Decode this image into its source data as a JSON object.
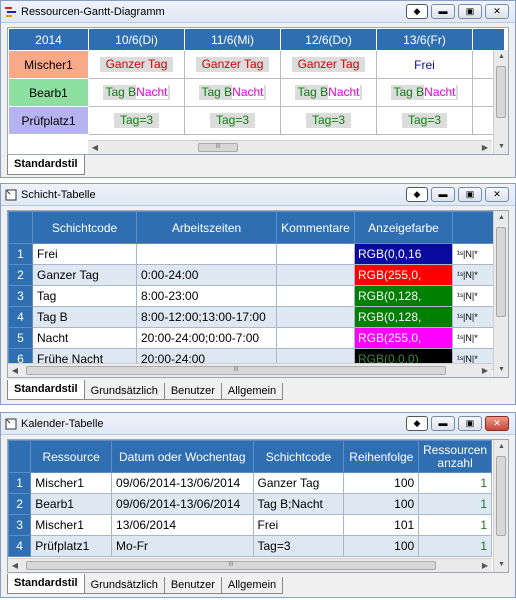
{
  "windows": {
    "gantt": {
      "title": "Ressourcen-Gantt-Diagramm",
      "year": "2014",
      "dates": [
        "10/6(Di)",
        "11/6(Mi)",
        "12/6(Do)",
        "13/6(Fr)"
      ],
      "resources": [
        {
          "name": "Mischer1",
          "color": "#f7a98a",
          "cells": [
            "Ganzer Tag",
            "Ganzer Tag",
            "Ganzer Tag",
            "Frei"
          ]
        },
        {
          "name": "Bearb1",
          "color": "#8ee0a0",
          "cells": [
            "Tag B|Nacht",
            "Tag B|Nacht",
            "Tag B|Nacht",
            "Tag B|Nacht"
          ]
        },
        {
          "name": "Prüfplatz1",
          "color": "#b5b3f0",
          "cells": [
            "Tag=3",
            "Tag=3",
            "Tag=3",
            "Tag=3"
          ]
        }
      ],
      "tabs": [
        "Standardstil"
      ]
    },
    "schicht": {
      "title": "Schicht-Tabelle",
      "columns": [
        "Schichtcode",
        "Arbeitszeiten",
        "Kommentare",
        "Anzeigefarbe"
      ],
      "rows": [
        {
          "n": "1",
          "code": "Frei",
          "zeit": "",
          "komm": "",
          "farbe": "RGB(0,0,16",
          "bg": "#0a0aa0"
        },
        {
          "n": "2",
          "code": "Ganzer Tag",
          "zeit": "0:00-24:00",
          "komm": "",
          "farbe": "RGB(255,0,",
          "bg": "#ff0000"
        },
        {
          "n": "3",
          "code": "Tag",
          "zeit": "8:00-23:00",
          "komm": "",
          "farbe": "RGB(0,128,",
          "bg": "#008000"
        },
        {
          "n": "4",
          "code": "Tag B",
          "zeit": "8:00-12:00;13:00-17:00",
          "komm": "",
          "farbe": "RGB(0,128,",
          "bg": "#008000"
        },
        {
          "n": "5",
          "code": "Nacht",
          "zeit": "20:00-24:00;0:00-7:00",
          "komm": "",
          "farbe": "RGB(255,0,",
          "bg": "#ff00ff"
        },
        {
          "n": "6",
          "code": "Frühe Nacht",
          "zeit": "20:00-24:00",
          "komm": "",
          "farbe": "RGB(0,0,0)",
          "bg": "#000000"
        }
      ],
      "tabs": [
        "Standardstil",
        "Grundsätzlich",
        "Benutzer",
        "Allgemein"
      ]
    },
    "kalender": {
      "title": "Kalender-Tabelle",
      "columns": [
        "Ressource",
        "Datum oder Wochentag",
        "Schichtcode",
        "Reihenfolge",
        "Ressourcen anzahl"
      ],
      "rows": [
        {
          "n": "1",
          "res": "Mischer1",
          "datum": "09/06/2014-13/06/2014",
          "code": "Ganzer Tag",
          "reihe": "100",
          "anz": "1"
        },
        {
          "n": "2",
          "res": "Bearb1",
          "datum": "09/06/2014-13/06/2014",
          "code": "Tag B;Nacht",
          "reihe": "100",
          "anz": "1"
        },
        {
          "n": "3",
          "res": "Mischer1",
          "datum": "13/06/2014",
          "code": "Frei",
          "reihe": "101",
          "anz": "1"
        },
        {
          "n": "4",
          "res": "Prüfplatz1",
          "datum": "Mo-Fr",
          "code": "Tag=3",
          "reihe": "100",
          "anz": "1"
        }
      ],
      "tabs": [
        "Standardstil",
        "Grundsätzlich",
        "Benutzer",
        "Allgemein"
      ]
    }
  }
}
